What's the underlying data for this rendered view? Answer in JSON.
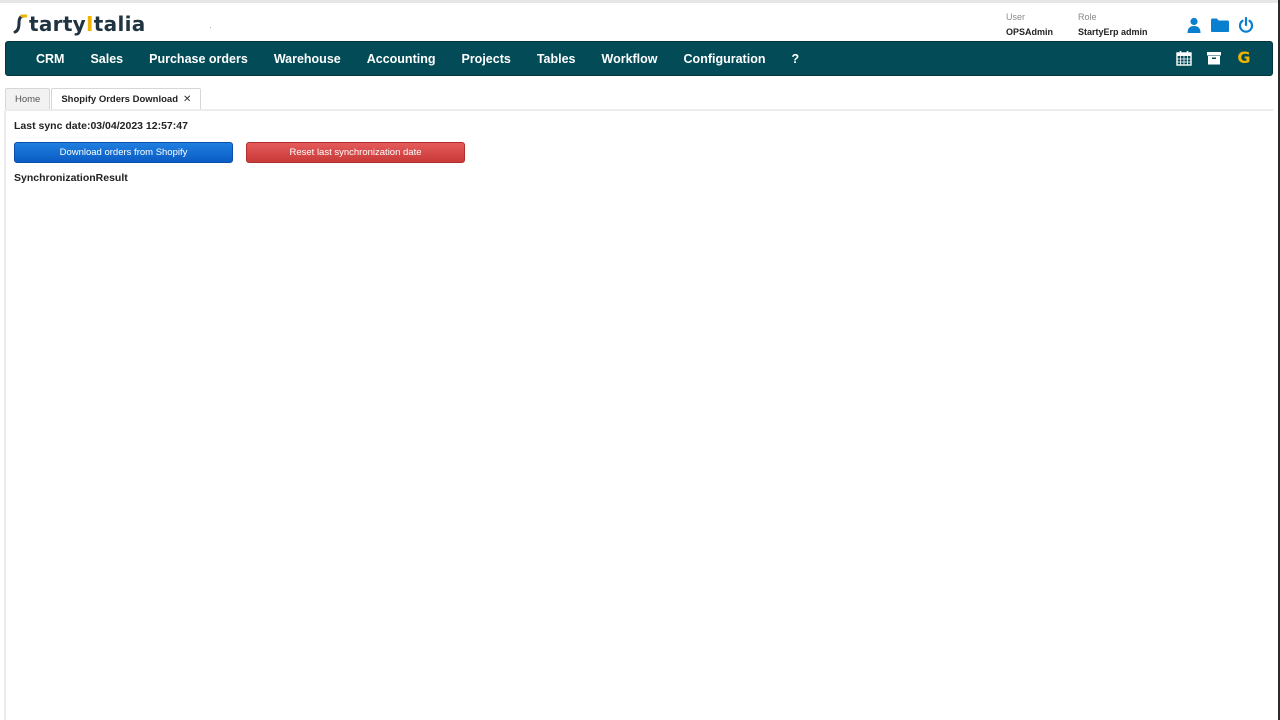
{
  "header": {
    "logo_text_pre": "tarty",
    "logo_text_pipe": "I",
    "logo_text_post": "talia",
    "user_label": "User",
    "user_value": "OPSAdmin",
    "role_label": "Role",
    "role_value": "StartyErp admin",
    "icons": [
      "user-icon",
      "folder-icon",
      "power-icon"
    ],
    "accent_color": "#0a7fd0"
  },
  "navbar": {
    "background": "#034b56",
    "items": [
      {
        "label": "CRM"
      },
      {
        "label": "Sales"
      },
      {
        "label": "Purchase orders"
      },
      {
        "label": "Warehouse"
      },
      {
        "label": "Accounting"
      },
      {
        "label": "Projects"
      },
      {
        "label": "Tables"
      },
      {
        "label": "Workflow"
      },
      {
        "label": "Configuration"
      },
      {
        "label": "?"
      }
    ],
    "right_icons": [
      "calendar-icon",
      "archive-icon",
      "g-icon"
    ],
    "g_label": "G"
  },
  "tabs": [
    {
      "label": "Home",
      "active": false
    },
    {
      "label": "Shopify Orders Download",
      "active": true,
      "close": "✕"
    }
  ],
  "main": {
    "last_sync_label": "Last sync date:",
    "last_sync_value": "03/04/2023 12:57:47",
    "download_button": "Download orders from Shopify",
    "reset_button": "Reset last synchronization date",
    "result_label": "SynchronizationResult"
  }
}
